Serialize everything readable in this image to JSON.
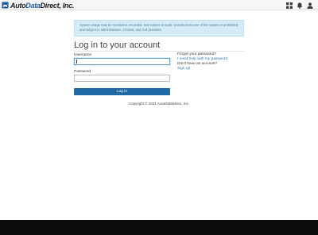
{
  "header": {
    "logo_prefix": "Auto",
    "logo_highlight": "Data",
    "logo_suffix": "Direct, Inc.",
    "icons": [
      "apps-grid-icon",
      "notifications-bell-icon",
      "user-account-icon"
    ]
  },
  "notice": {
    "text": "System usage may be monitored, recorded, and subject to audit. Unauthorized use of the system is prohibited and subject to administrative, criminal, and civil penalties."
  },
  "login": {
    "title": "Log in to your account",
    "username_label": "Username",
    "username_value": "",
    "password_label": "Password",
    "password_value": "",
    "submit_label": "Log in"
  },
  "help": {
    "forgot_question": "Forgot your password?",
    "forgot_link": "I need help with my password",
    "account_question": "Don't have an account?",
    "signup_link": "Sign up"
  },
  "footer": {
    "copyright": "Copyright © 2021 AutoDataDirect, Inc."
  },
  "colors": {
    "accent": "#1f6aa5",
    "link": "#2b74b5",
    "notice_bg": "#d5ecf7",
    "notice_text": "#4f7f96",
    "footer_bg": "#0c0c0c"
  }
}
